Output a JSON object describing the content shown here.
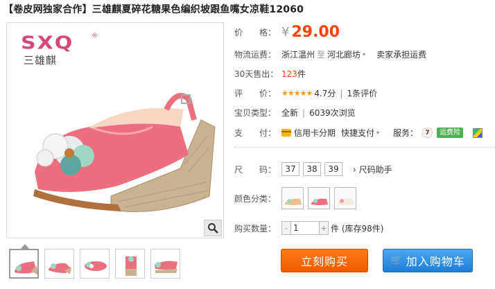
{
  "title": "【卷皮网独家合作】三雄麒夏碎花糖果色编织坡跟鱼嘴女凉鞋12060",
  "logo": {
    "brand": "SXQ",
    "sub": "三雄麒",
    "reg": "®"
  },
  "price": {
    "label": "价　　格：",
    "currency": "¥",
    "value": "29.00"
  },
  "shipping": {
    "label": "物流运费：",
    "from": "浙江温州",
    "sep": "至",
    "to": "河北廊坊",
    "note": "卖家承担运费"
  },
  "sales": {
    "label": "30天售出：",
    "value": "123",
    "unit": "件"
  },
  "rating": {
    "label": "评　　价：",
    "stars": "★★★★★",
    "score": "4.7分",
    "sep": "|",
    "reviews": "1条评价"
  },
  "type": {
    "label": "宝贝类型：",
    "value": "全新",
    "sep": "|",
    "views": "6039次浏览"
  },
  "payment": {
    "label": "支　　付：",
    "credit": "信用卡分期",
    "quick": "快捷支付",
    "service_label": "服务：",
    "service_icon": "7",
    "badge": "运费险"
  },
  "size": {
    "label": "尺　　码：",
    "options": [
      "37",
      "38",
      "39"
    ],
    "help": "› 尺码助手"
  },
  "color": {
    "label": "颜色分类："
  },
  "quantity": {
    "label": "购买数量：",
    "minus": "-",
    "value": "1",
    "plus": "+",
    "stock": "件 (库存98件)"
  },
  "buttons": {
    "buy": "立刻购买",
    "cart": "加入购物车",
    "cart_icon": "🛒"
  },
  "colors": {
    "price": "#ff4400",
    "buy_button": "#f05a00",
    "cart_button": "#1f7fd8",
    "brand": "#d4487a"
  }
}
